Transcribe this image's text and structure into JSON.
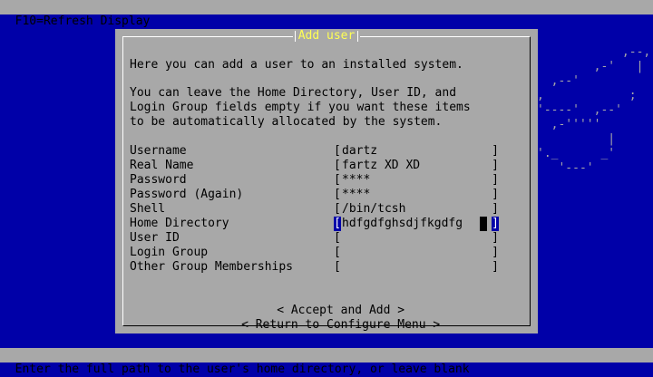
{
  "top_bar": {
    "text": "F10=Refresh Display"
  },
  "bottom_bar": {
    "text": "Enter the full path to the user's home directory, or leave blank"
  },
  "dialog": {
    "title": "Add user",
    "intro1": "Here you can add a user to an installed system.",
    "intro2": [
      "You can leave the Home Directory, User ID, and",
      "Login Group fields empty if you want these items",
      "to be automatically allocated by the system."
    ],
    "fields": [
      {
        "label": "Username",
        "value": "dartz"
      },
      {
        "label": "Real Name",
        "value": "fartz XD XD"
      },
      {
        "label": "Password",
        "value": "****"
      },
      {
        "label": "Password (Again)",
        "value": "****"
      },
      {
        "label": "Shell",
        "value": "/bin/tcsh"
      },
      {
        "label": "Home Directory",
        "value": "hdfgdfghsdjfkgdfg"
      },
      {
        "label": "User ID",
        "value": ""
      },
      {
        "label": "Login Group",
        "value": ""
      },
      {
        "label": "Other Group Memberships",
        "value": ""
      }
    ],
    "buttons": {
      "accept": "< Accept and Add >",
      "return": "< Return to Configure Menu >"
    }
  },
  "art": {
    "lines": [
      "            ,--,",
      "        ,-'   |",
      "  ,--'        ",
      ",            ;",
      "'----'  ,--'",
      "  ,-'''''",
      "          |",
      "'._      _'",
      "   '---'"
    ]
  },
  "colors": {
    "background": "#0000a8",
    "dialog": "#a8a8a8",
    "title": "#ffff54"
  }
}
